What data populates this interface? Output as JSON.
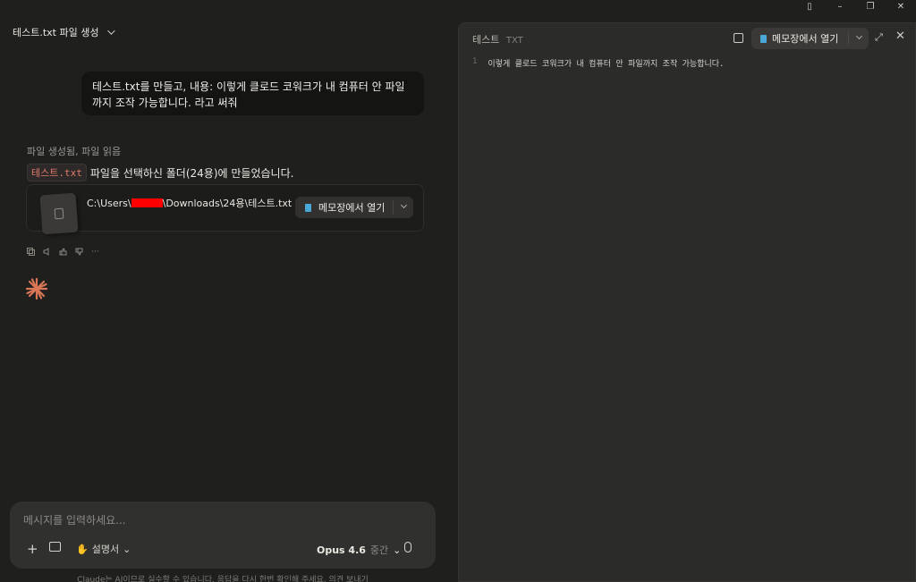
{
  "window": {
    "sidebar_icon": "▯",
    "minimize": "–",
    "restore": "❐",
    "close": "✕"
  },
  "conversation": {
    "title": "테스트.txt 파일 생성"
  },
  "user_message": "테스트.txt를 만들고, 내용: 이렇게 클로드 코워크가 내 컴퓨터 안 파일까지 조작 가능합니다. 라고 써줘",
  "assistant": {
    "tool_summary": "파일 생성됨, 파일 읽음",
    "file_tag": "테스트.txt",
    "reply_text": "파일을 선택하신 폴더(24용)에 만들었습니다.",
    "file_card": {
      "path_prefix": "C:\\Users\\",
      "path_suffix": "\\Downloads\\24용\\테스트.txt",
      "open_label": "메모장에서 열기"
    },
    "actions": [
      "copy-icon",
      "speaker-icon",
      "thumbs-up-icon",
      "thumbs-down-icon",
      "more-icon"
    ],
    "more_glyph": "···"
  },
  "composer": {
    "placeholder": "메시지를 입력하세요...",
    "plus": "+",
    "style_label": "설명서",
    "model_name": "Opus 4.6",
    "effort": "중간"
  },
  "disclaimer": "Claude는 AI이므로 실수할 수 있습니다. 응답을 다시 한번 확인해 주세요. 의견 보내기",
  "preview": {
    "title": "테스트",
    "type": "TXT",
    "open_label": "메모장에서 열기",
    "expand": "⤢",
    "close": "✕",
    "lines": [
      {
        "num": "1",
        "text": "이렇게 클로드 코워크가 내 컴퓨터 안 파일까지 조작 가능합니다."
      }
    ]
  },
  "colors": {
    "accent_spark": "#d97757",
    "redaction": "#ff0000",
    "notepad_icon": "#4aa8d8"
  }
}
